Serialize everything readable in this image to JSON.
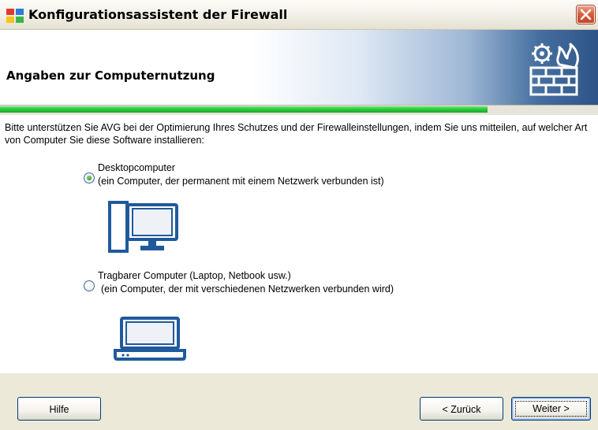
{
  "window": {
    "title": "Konfigurationsassistent der Firewall",
    "close_icon": "close-icon"
  },
  "header": {
    "title": "Angaben zur Computernutzung",
    "icon": "firewall-icon"
  },
  "progress": {
    "value": 0.815,
    "color": "#2ccb3c"
  },
  "intro": "Bitte unterstützen Sie AVG bei der Optimierung Ihres Schutzes und der Firewalleinstellungen, indem Sie uns mitteilen, auf welcher Art von Computer Sie diese Software installieren:",
  "options": [
    {
      "label": "Desktopcomputer",
      "description": "(ein Computer, der permanent mit einem Netzwerk verbunden ist)",
      "selected": true,
      "icon": "desktop-computer-icon"
    },
    {
      "label": "Tragbarer Computer (Laptop, Netbook usw.)",
      "description": "(ein Computer, der mit verschiedenen Netzwerken verbunden wird)",
      "selected": false,
      "icon": "laptop-icon"
    }
  ],
  "footer": {
    "help_label": "Hilfe",
    "back_label": "< Zurück",
    "next_label": "Weiter >"
  },
  "colors": {
    "accent_blue": "#1f5a9c",
    "progress_green": "#2ccb3c"
  }
}
